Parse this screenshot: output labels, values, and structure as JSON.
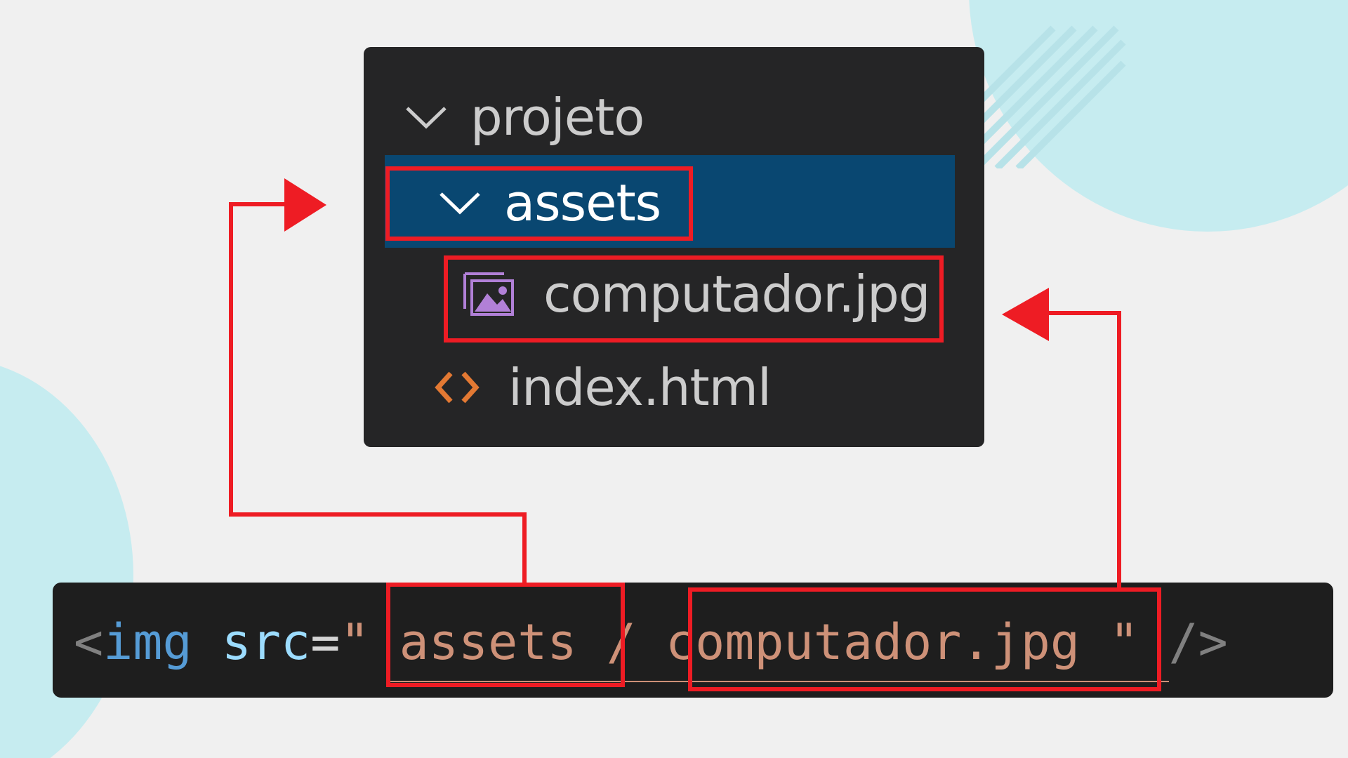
{
  "explorer": {
    "root": "projeto",
    "folder": "assets",
    "image_file": "computador.jpg",
    "html_file": "index.html"
  },
  "code": {
    "open": "<",
    "tag": "img",
    "attr": "src",
    "eq": "=",
    "quote_open": "\"",
    "path_folder": "assets",
    "slash": "/",
    "path_file": "computador.jpg",
    "quote_close": "\"",
    "close": "/>"
  },
  "icons": {
    "root_chevron": "chevron-down-icon",
    "folder_chevron": "chevron-down-icon",
    "image": "image-file-icon",
    "html": "code-brackets-icon"
  },
  "colors": {
    "background": "#f0f0f0",
    "accent_circle": "#c6ecf0",
    "panel": "#252526",
    "selection": "#094771",
    "highlight": "#ee1c24",
    "code_tag": "#569cd6",
    "code_attr": "#9cdcfe",
    "code_string": "#ce9178",
    "image_icon": "#b180d7",
    "html_icon": "#e37933"
  }
}
